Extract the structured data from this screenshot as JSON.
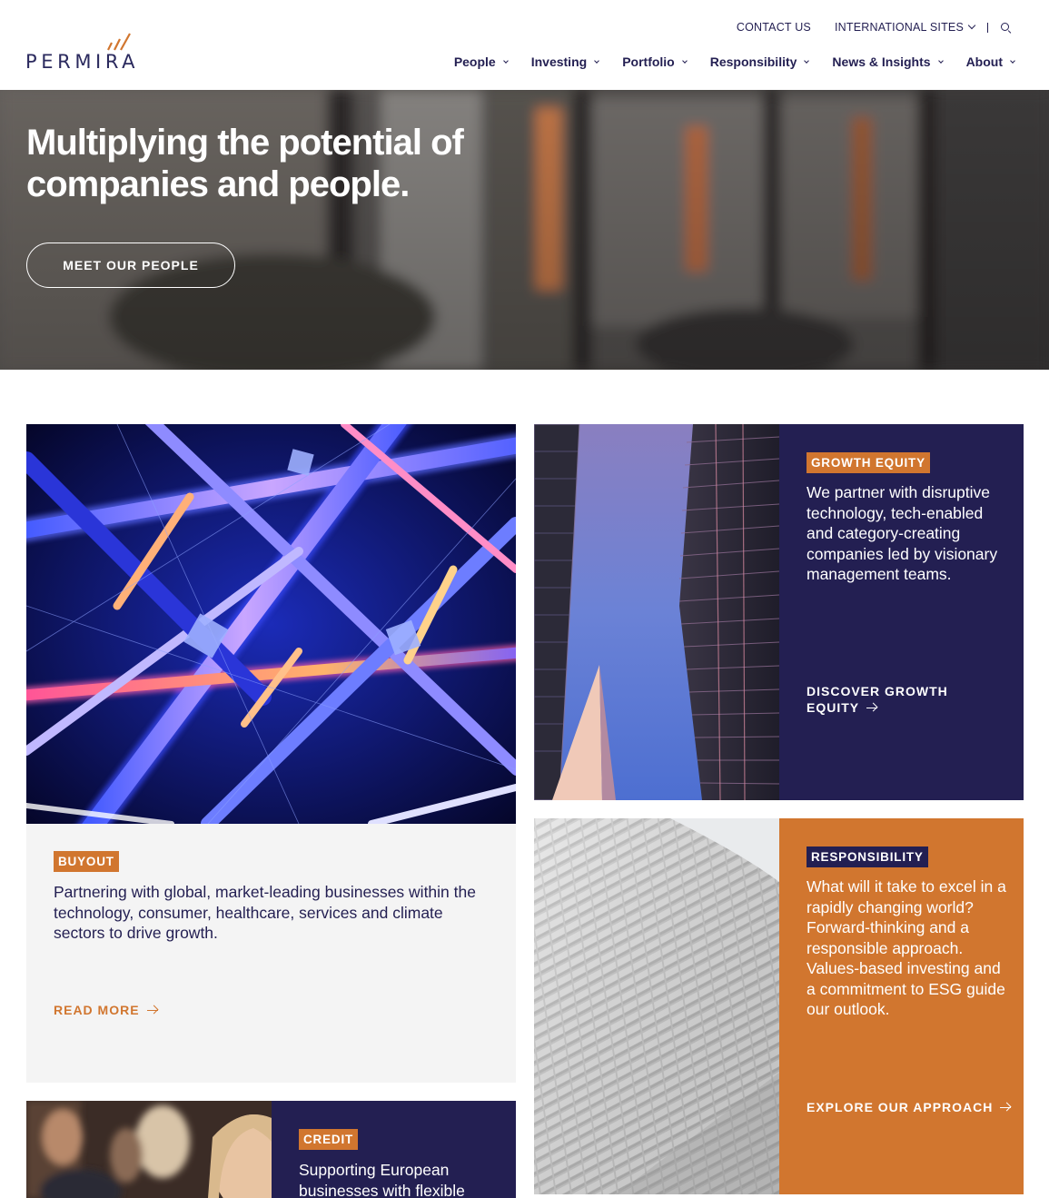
{
  "brand": {
    "name": "PERMIRA",
    "navy": "#231f52",
    "orange": "#d1762f"
  },
  "utility_nav": {
    "contact": "CONTACT US",
    "international": "INTERNATIONAL SITES"
  },
  "main_nav": [
    "People",
    "Investing",
    "Portfolio",
    "Responsibility",
    "News & Insights",
    "About"
  ],
  "hero": {
    "title_line1": "Multiplying the potential of",
    "title_line2": "companies and people.",
    "button": "MEET OUR PEOPLE"
  },
  "cards": {
    "buyout": {
      "tag": "BUYOUT",
      "text": "Partnering with global, market-leading businesses within the technology, consumer, healthcare, services and climate sectors to drive growth.",
      "cta": "READ MORE"
    },
    "growth": {
      "tag": "GROWTH EQUITY",
      "text": "We partner with disruptive technology, tech-enabled and category-creating companies led by visionary management teams.",
      "cta_line1": "DISCOVER GROWTH",
      "cta_line2": "EQUITY"
    },
    "responsibility": {
      "tag": "RESPONSIBILITY",
      "text": "What will it take to excel in a rapidly changing world? Forward-thinking and a responsible approach. Values-based investing and a commitment to ESG guide our outlook.",
      "cta": "EXPLORE OUR APPROACH"
    },
    "credit": {
      "tag": "CREDIT",
      "text": "Supporting European businesses with flexible"
    }
  }
}
